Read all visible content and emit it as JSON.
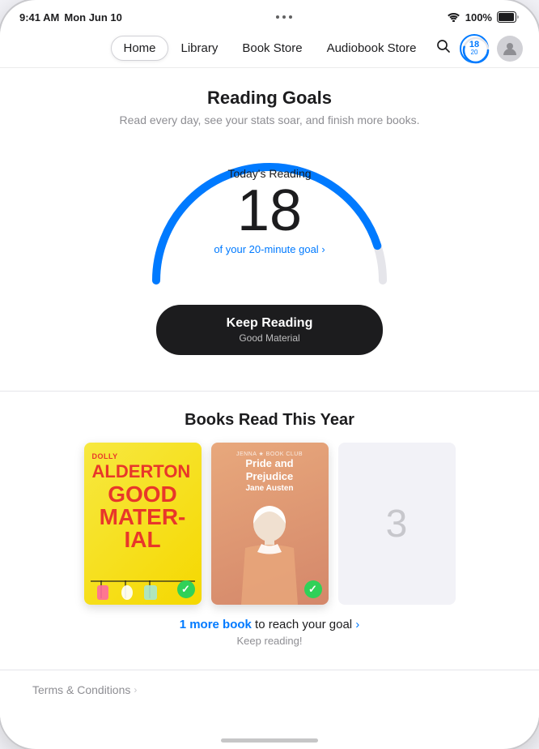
{
  "statusBar": {
    "time": "9:41 AM",
    "date": "Mon Jun 10",
    "dots": 3,
    "wifi": "wifi",
    "battery": "100%"
  },
  "nav": {
    "items": [
      {
        "label": "Home",
        "active": true
      },
      {
        "label": "Library",
        "active": false
      },
      {
        "label": "Book Store",
        "active": false
      },
      {
        "label": "Audiobook Store",
        "active": false
      }
    ],
    "readingBadge": {
      "number": "18",
      "sub": "20"
    },
    "searchLabel": "Search"
  },
  "readingGoals": {
    "title": "Reading Goals",
    "subtitle": "Read every day, see your stats soar, and finish more books.",
    "todayLabel": "Today's Reading",
    "minutes": "18",
    "goalLabel": "of your 20-minute goal",
    "goalChevron": ">",
    "keepReadingLabel": "Keep Reading",
    "keepReadingSub": "Good Material"
  },
  "booksSection": {
    "title": "Books Read This Year",
    "books": [
      {
        "title": "Good Material",
        "author": "Dolly Alderton",
        "checked": true,
        "coverStyle": "book1"
      },
      {
        "title": "Pride and Prejudice",
        "author": "Jane Austen",
        "checked": true,
        "coverStyle": "book2"
      },
      {
        "number": "3",
        "coverStyle": "book3"
      }
    ],
    "ctaText": "1 more book",
    "ctaRest": " to reach your goal",
    "ctaChevron": ">",
    "ctaSub": "Keep reading!"
  },
  "terms": {
    "label": "Terms & Conditions",
    "chevron": ">"
  }
}
